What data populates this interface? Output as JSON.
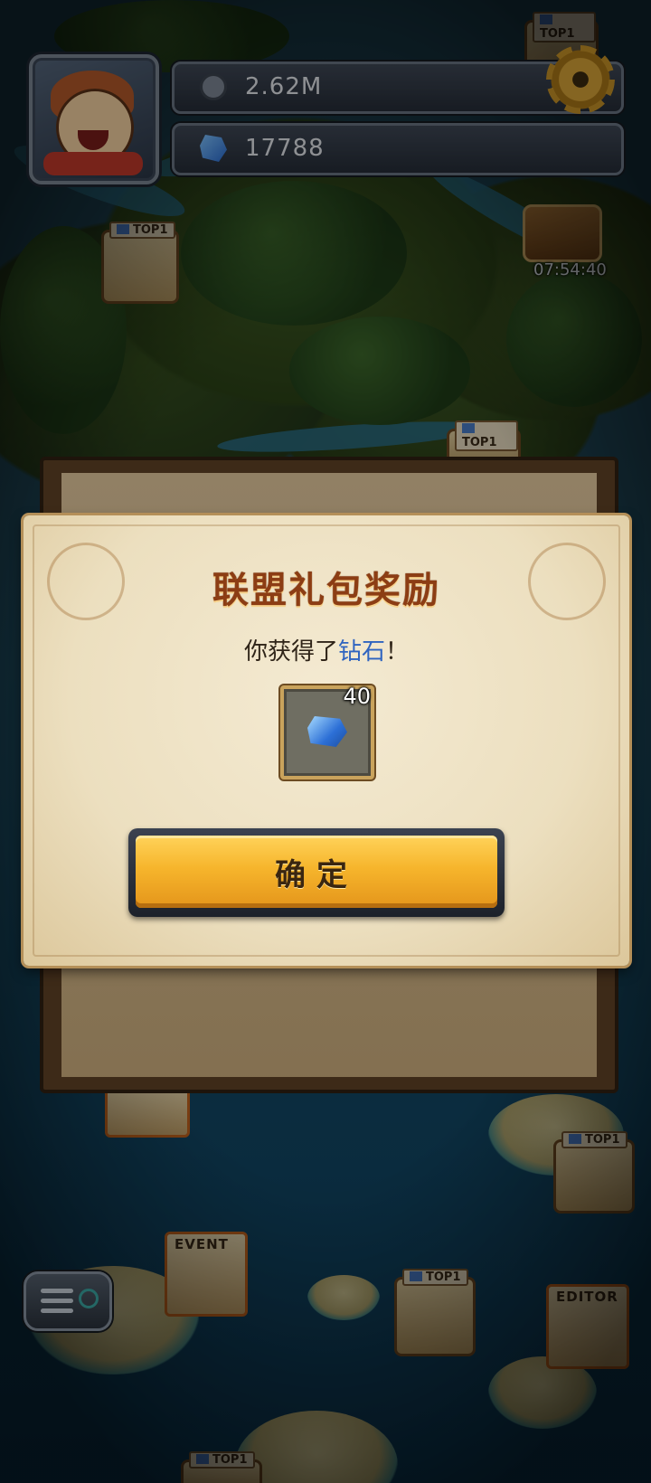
{
  "hud": {
    "coins": "2.62M",
    "gems": "17788",
    "chest_timer": "07:54:40"
  },
  "map": {
    "markers": [
      {
        "tag": "TOP1"
      },
      {
        "tag": "TOP1"
      },
      {
        "tag": "TOP1"
      },
      {
        "tag": "TOP1"
      },
      {
        "tag": "TOP1"
      },
      {
        "tag": "TOP1"
      }
    ],
    "event_label": "EVENT",
    "editor_label": "EDITOR"
  },
  "dialog": {
    "title": "联盟礼包奖励",
    "message_prefix": "你获得了",
    "message_item": "钻石",
    "message_suffix": "！",
    "reward_count": "40",
    "confirm_label": "确定"
  },
  "colors": {
    "title": "#8c3d14",
    "highlight": "#2f64c0",
    "button": "#f6b52c"
  }
}
